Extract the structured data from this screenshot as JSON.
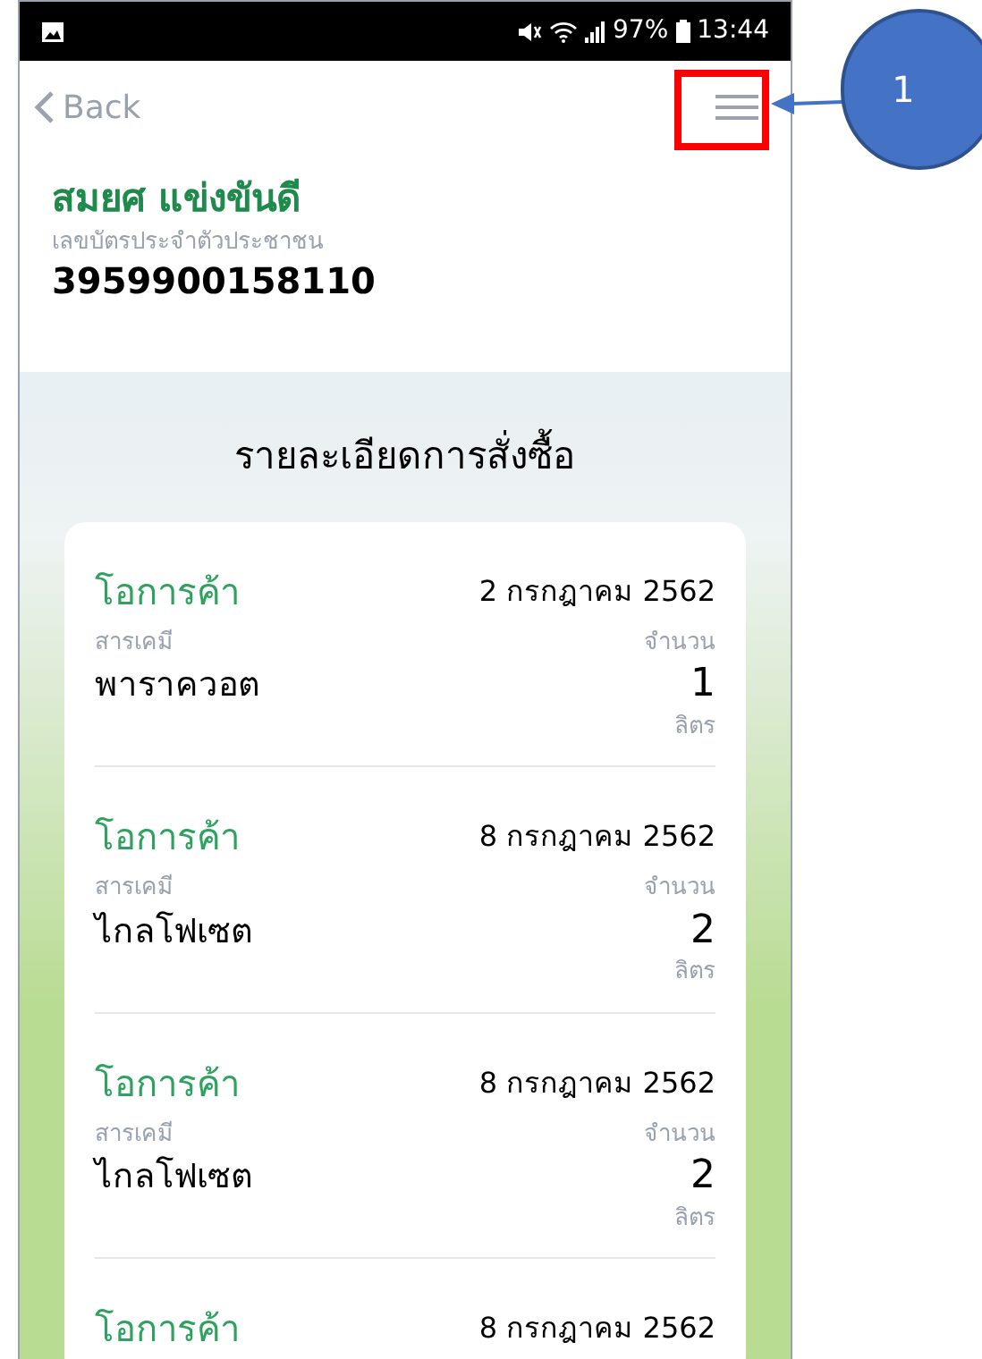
{
  "status_bar": {
    "battery": "97%",
    "time": "13:44"
  },
  "nav": {
    "back": "Back"
  },
  "profile": {
    "name": "สมยศ แข่งขันดี",
    "id_label": "เลขบัตรประจำตัวประชาชน",
    "id_number": "3959900158110"
  },
  "section_title": "รายละเอียดการสั่งซื้อ",
  "orders": [
    {
      "shop": "โอการค้า",
      "date": "2 กรกฎาคม 2562",
      "chemical_label": "สารเคมี",
      "chemical": "พาราควอต",
      "amount_label": "จำนวน",
      "amount": "1",
      "unit": "ลิตร"
    },
    {
      "shop": "โอการค้า",
      "date": "8 กรกฎาคม 2562",
      "chemical_label": "สารเคมี",
      "chemical": "ไกลโฟเซต",
      "amount_label": "จำนวน",
      "amount": "2",
      "unit": "ลิตร"
    },
    {
      "shop": "โอการค้า",
      "date": "8 กรกฎาคม 2562",
      "chemical_label": "สารเคมี",
      "chemical": "ไกลโฟเซต",
      "amount_label": "จำนวน",
      "amount": "2",
      "unit": "ลิตร"
    },
    {
      "shop": "โอการค้า",
      "date": "8 กรกฎาคม 2562"
    }
  ],
  "callout": {
    "number": "1"
  }
}
